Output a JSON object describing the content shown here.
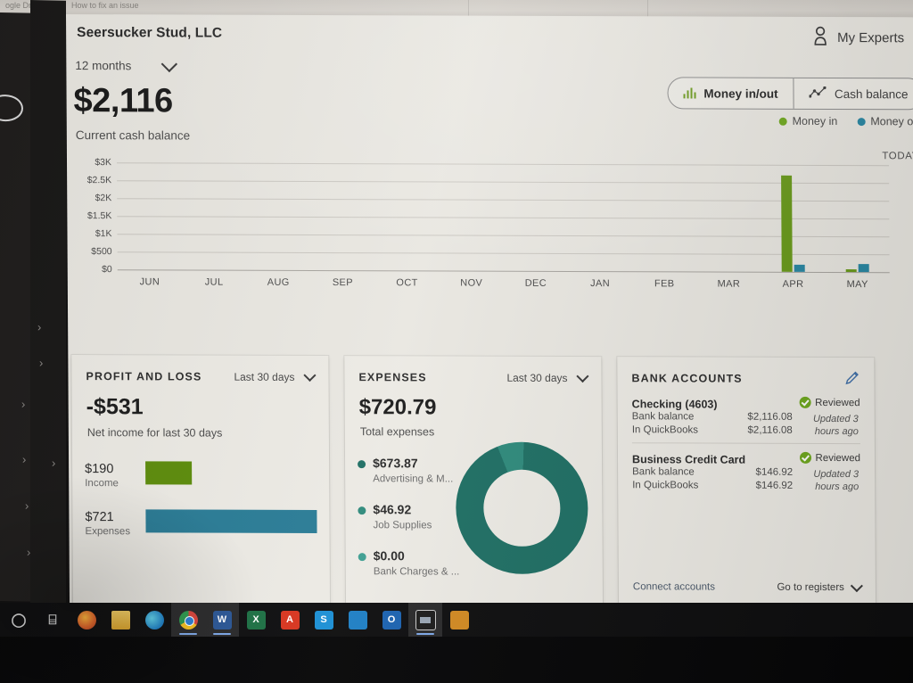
{
  "browser": {
    "tab_left": "ogle Drive",
    "tab_right": "How to fix an issue"
  },
  "header": {
    "menu_icon": "hamburger-icon",
    "company": "Seersucker Stud, LLC",
    "experts_icon": "person-icon",
    "experts_label": "My Experts"
  },
  "cash": {
    "period": "12 months",
    "amount": "$2,116",
    "caption": "Current cash balance",
    "today_label": "TODAY"
  },
  "toggle": {
    "money_icon": "bar-chart-icon",
    "money_label": "Money in/out",
    "cash_icon": "line-chart-icon",
    "cash_label": "Cash balance"
  },
  "legend": {
    "in_label": "Money in",
    "in_color": "#6fa81e",
    "out_label": "Money out",
    "out_color": "#2a87a3"
  },
  "chart_data": {
    "type": "bar",
    "title": "Current cash balance",
    "xlabel": "",
    "ylabel": "",
    "ylim": [
      0,
      3000
    ],
    "grid": true,
    "legend_position": "top-right",
    "categories": [
      "JUN",
      "JUL",
      "AUG",
      "SEP",
      "OCT",
      "NOV",
      "DEC",
      "JAN",
      "FEB",
      "MAR",
      "APR",
      "MAY"
    ],
    "ytick_labels": [
      "$0",
      "$500",
      "$1K",
      "$1.5K",
      "$2K",
      "$2.5K",
      "$3K"
    ],
    "ytick_values": [
      0,
      500,
      1000,
      1500,
      2000,
      2500,
      3000
    ],
    "series": [
      {
        "name": "Money in",
        "color": "#6a9a1c",
        "values": [
          0,
          0,
          0,
          0,
          0,
          0,
          0,
          0,
          0,
          0,
          2700,
          70
        ]
      },
      {
        "name": "Money out",
        "color": "#2a87a3",
        "values": [
          0,
          0,
          0,
          0,
          0,
          0,
          0,
          0,
          0,
          0,
          190,
          230
        ]
      }
    ]
  },
  "pnl": {
    "title": "PROFIT AND LOSS",
    "range": "Last 30 days",
    "amount": "-$531",
    "subtitle": "Net income for last 30 days",
    "income_value": "$190",
    "income_label": "Income",
    "income_color": "#5d8c0c",
    "expenses_value": "$721",
    "expenses_label": "Expenses",
    "expenses_color": "#2a7c96"
  },
  "expenses": {
    "title": "EXPENSES",
    "range": "Last 30 days",
    "amount": "$720.79",
    "subtitle": "Total expenses",
    "items": [
      {
        "value": "$673.87",
        "category": "Advertising & M...",
        "color": "#1f6f64",
        "pct": 93.5
      },
      {
        "value": "$46.92",
        "category": "Job Supplies",
        "color": "#2f8a7c",
        "pct": 6.5
      },
      {
        "value": "$0.00",
        "category": "Bank Charges & ...",
        "color": "#3f9f92",
        "pct": 0
      }
    ]
  },
  "bank": {
    "title": "BANK ACCOUNTS",
    "edit_icon": "pencil-icon",
    "accounts": [
      {
        "name": "Checking (4603)",
        "status": "Reviewed",
        "status_icon": "check-circle-icon",
        "updated": "Updated 3 hours ago",
        "rows": [
          {
            "label": "Bank balance",
            "value": "$2,116.08"
          },
          {
            "label": "In QuickBooks",
            "value": "$2,116.08"
          }
        ]
      },
      {
        "name": "Business Credit Card",
        "status": "Reviewed",
        "status_icon": "check-circle-icon",
        "updated": "Updated 3 hours ago",
        "rows": [
          {
            "label": "Bank balance",
            "value": "$146.92"
          },
          {
            "label": "In QuickBooks",
            "value": "$146.92"
          }
        ]
      }
    ],
    "connect_label": "Connect accounts",
    "registers_label": "Go to registers"
  },
  "taskbar": {
    "items": [
      {
        "name": "cortana",
        "icon": "circle-icon",
        "color": "#0e0e0f",
        "glyph": "◯",
        "active": false
      },
      {
        "name": "task-view",
        "icon": "task-view-icon",
        "color": "#0e0e0f",
        "glyph": "⌸",
        "active": false
      },
      {
        "name": "firefox",
        "icon": "firefox-icon",
        "color": "#e0682a",
        "glyph": "",
        "active": false
      },
      {
        "name": "file-explorer",
        "icon": "folder-icon",
        "color": "#e3b33c",
        "glyph": "",
        "active": false
      },
      {
        "name": "edge",
        "icon": "edge-icon",
        "color": "#2a8fd4",
        "glyph": "",
        "active": false
      },
      {
        "name": "chrome",
        "icon": "chrome-icon",
        "color": "#e8ab12",
        "glyph": "",
        "active": true
      },
      {
        "name": "word",
        "icon": "word-icon",
        "color": "#2b5797",
        "glyph": "W",
        "active": true
      },
      {
        "name": "excel",
        "icon": "excel-icon",
        "color": "#1d7044",
        "glyph": "X",
        "active": false
      },
      {
        "name": "acrobat",
        "icon": "acrobat-icon",
        "color": "#d8351f",
        "glyph": "A",
        "active": false
      },
      {
        "name": "skype",
        "icon": "skype-icon",
        "color": "#1b8fd4",
        "glyph": "S",
        "active": false
      },
      {
        "name": "blue-app",
        "icon": "app-icon",
        "color": "#1e7fc4",
        "glyph": "",
        "active": false
      },
      {
        "name": "outlook",
        "icon": "outlook-icon",
        "color": "#1b62b0",
        "glyph": "O",
        "active": false
      },
      {
        "name": "photos",
        "icon": "photos-icon",
        "color": "#20201f",
        "glyph": "",
        "active": true
      },
      {
        "name": "orange-app",
        "icon": "app-icon",
        "color": "#d28a22",
        "glyph": "",
        "active": false
      }
    ]
  }
}
